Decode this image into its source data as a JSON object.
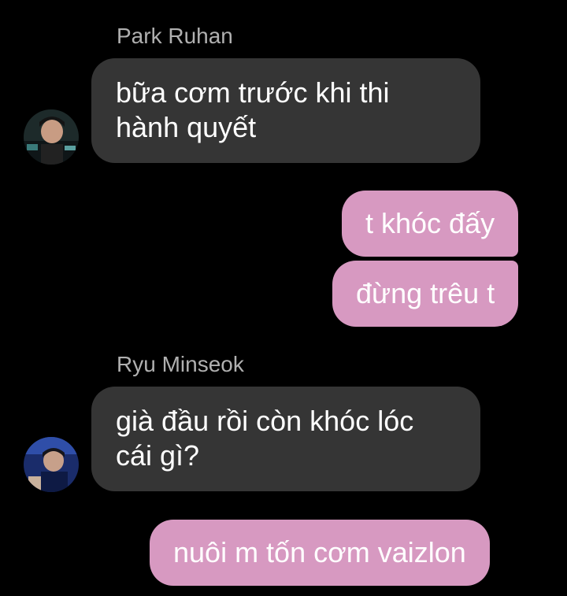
{
  "colors": {
    "background": "#000000",
    "incoming_bubble": "#353535",
    "outgoing_bubble": "#d799c1",
    "sender_name": "#b0b0b0",
    "message_text": "#ffffff"
  },
  "messages": [
    {
      "direction": "incoming",
      "sender": "Park Ruhan",
      "avatar": "avatar-photo-park-ruhan",
      "text": "bữa cơm trước khi thi hành quyết"
    },
    {
      "direction": "outgoing",
      "text": "t khóc đấy"
    },
    {
      "direction": "outgoing",
      "text": "đừng trêu t"
    },
    {
      "direction": "incoming",
      "sender": "Ryu Minseok",
      "avatar": "avatar-photo-ryu-minseok",
      "text": "già đầu rồi còn khóc lóc cái gì?"
    },
    {
      "direction": "outgoing",
      "text": "nuôi m tốn cơm vaizlon"
    }
  ]
}
